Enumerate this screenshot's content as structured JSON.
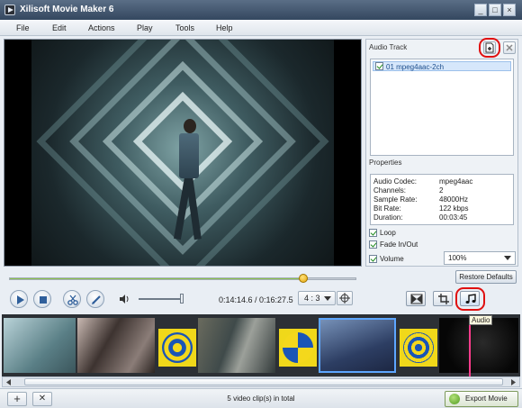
{
  "window": {
    "title": "Xilisoft Movie Maker 6",
    "controls": [
      "_",
      "□",
      "×"
    ]
  },
  "menu": [
    "File",
    "Edit",
    "Actions",
    "Play",
    "Tools",
    "Help"
  ],
  "player": {
    "progress_percent": 85,
    "volume_percent": 95,
    "time": "0:14:14.6 / 0:16:27.5",
    "aspect": "4 : 3",
    "buttons": [
      "play-icon",
      "stop-icon",
      "cut-icon",
      "edit-icon"
    ]
  },
  "audio_panel": {
    "title": "Audio Track",
    "tracks": [
      {
        "label": "01 mpeg4aac-2ch",
        "checked": true
      }
    ],
    "properties_title": "Properties",
    "properties": [
      {
        "key": "Audio Codec:",
        "value": "mpeg4aac"
      },
      {
        "key": "Channels:",
        "value": "2"
      },
      {
        "key": "Sample Rate:",
        "value": "48000Hz"
      },
      {
        "key": "Bit Rate:",
        "value": "122 kbps"
      },
      {
        "key": "Duration:",
        "value": "00:03:45"
      }
    ],
    "options": [
      {
        "label": "Loop",
        "checked": true
      },
      {
        "label": "Fade In/Out",
        "checked": true
      },
      {
        "label": "Volume",
        "checked": true
      }
    ],
    "volume_value": "100%",
    "restore_label": "Restore Defaults"
  },
  "tabs": {
    "active": "Audio",
    "tooltip": "Audio",
    "icons": [
      "transition-icon",
      "crop-icon",
      "music-note-icon"
    ]
  },
  "timeline": {
    "clip_count_text": "5 video clip(s) in total",
    "playhead_label": "Audio"
  },
  "statusbar": {
    "add_label": "+",
    "remove_label": "✕",
    "export_label": "Export Movie"
  },
  "colors": {
    "accent_red": "#e01010",
    "progress_green": "#8bc24a",
    "playhead_pink": "#ff3c8c"
  }
}
